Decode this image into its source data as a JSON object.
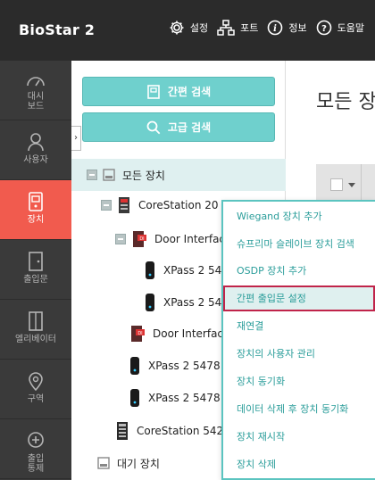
{
  "app": {
    "title": "BioStar 2"
  },
  "topnav": [
    {
      "label": "설정",
      "icon": "gear-icon"
    },
    {
      "label": "포트",
      "icon": "network-icon"
    },
    {
      "label": "정보",
      "icon": "info-icon"
    },
    {
      "label": "도움말",
      "icon": "help-icon"
    }
  ],
  "sidebar": {
    "items": [
      {
        "label_line1": "대시",
        "label_line2": "보드",
        "icon": "dashboard-icon",
        "active": false
      },
      {
        "label_line1": "사용자",
        "label_line2": "",
        "icon": "user-icon",
        "active": false
      },
      {
        "label_line1": "장치",
        "label_line2": "",
        "icon": "device-icon",
        "active": true
      },
      {
        "label_line1": "출입문",
        "label_line2": "",
        "icon": "door-icon",
        "active": false
      },
      {
        "label_line1": "엘리베이터",
        "label_line2": "",
        "icon": "elevator-icon",
        "active": false
      },
      {
        "label_line1": "구역",
        "label_line2": "",
        "icon": "zone-icon",
        "active": false
      },
      {
        "label_line1": "출입",
        "label_line2": "통제",
        "icon": "access-control-icon",
        "active": false
      }
    ]
  },
  "panel": {
    "quick_search": "간편 검색",
    "advanced_search": "고급 검색",
    "tree": [
      {
        "label": "모든 장치"
      },
      {
        "label": "CoreStation 20"
      },
      {
        "label": "Door Interfac"
      },
      {
        "label": "XPass 2 54"
      },
      {
        "label": "XPass 2 54"
      },
      {
        "label": "Door Interfac"
      },
      {
        "label": "XPass 2 5478"
      },
      {
        "label": "XPass 2 5478"
      },
      {
        "label": "CoreStation 542"
      },
      {
        "label": "대기 장치"
      }
    ]
  },
  "main": {
    "title": "모든 장"
  },
  "context_menu": {
    "items": [
      "Wiegand 장치 추가",
      "슈프리마 슬레이브 장치 검색",
      "OSDP 장치 추가",
      "간편 출입문 설정",
      "재연결",
      "장치의 사용자 관리",
      "장치 동기화",
      "데이터 삭제 후 장치 동기화",
      "장치 재시작",
      "장치 삭제"
    ]
  },
  "colors": {
    "accent": "#6fd0cd",
    "active_nav": "#f15b4e",
    "menu_text": "#2a9d9a",
    "highlight_border": "#c0244a"
  }
}
